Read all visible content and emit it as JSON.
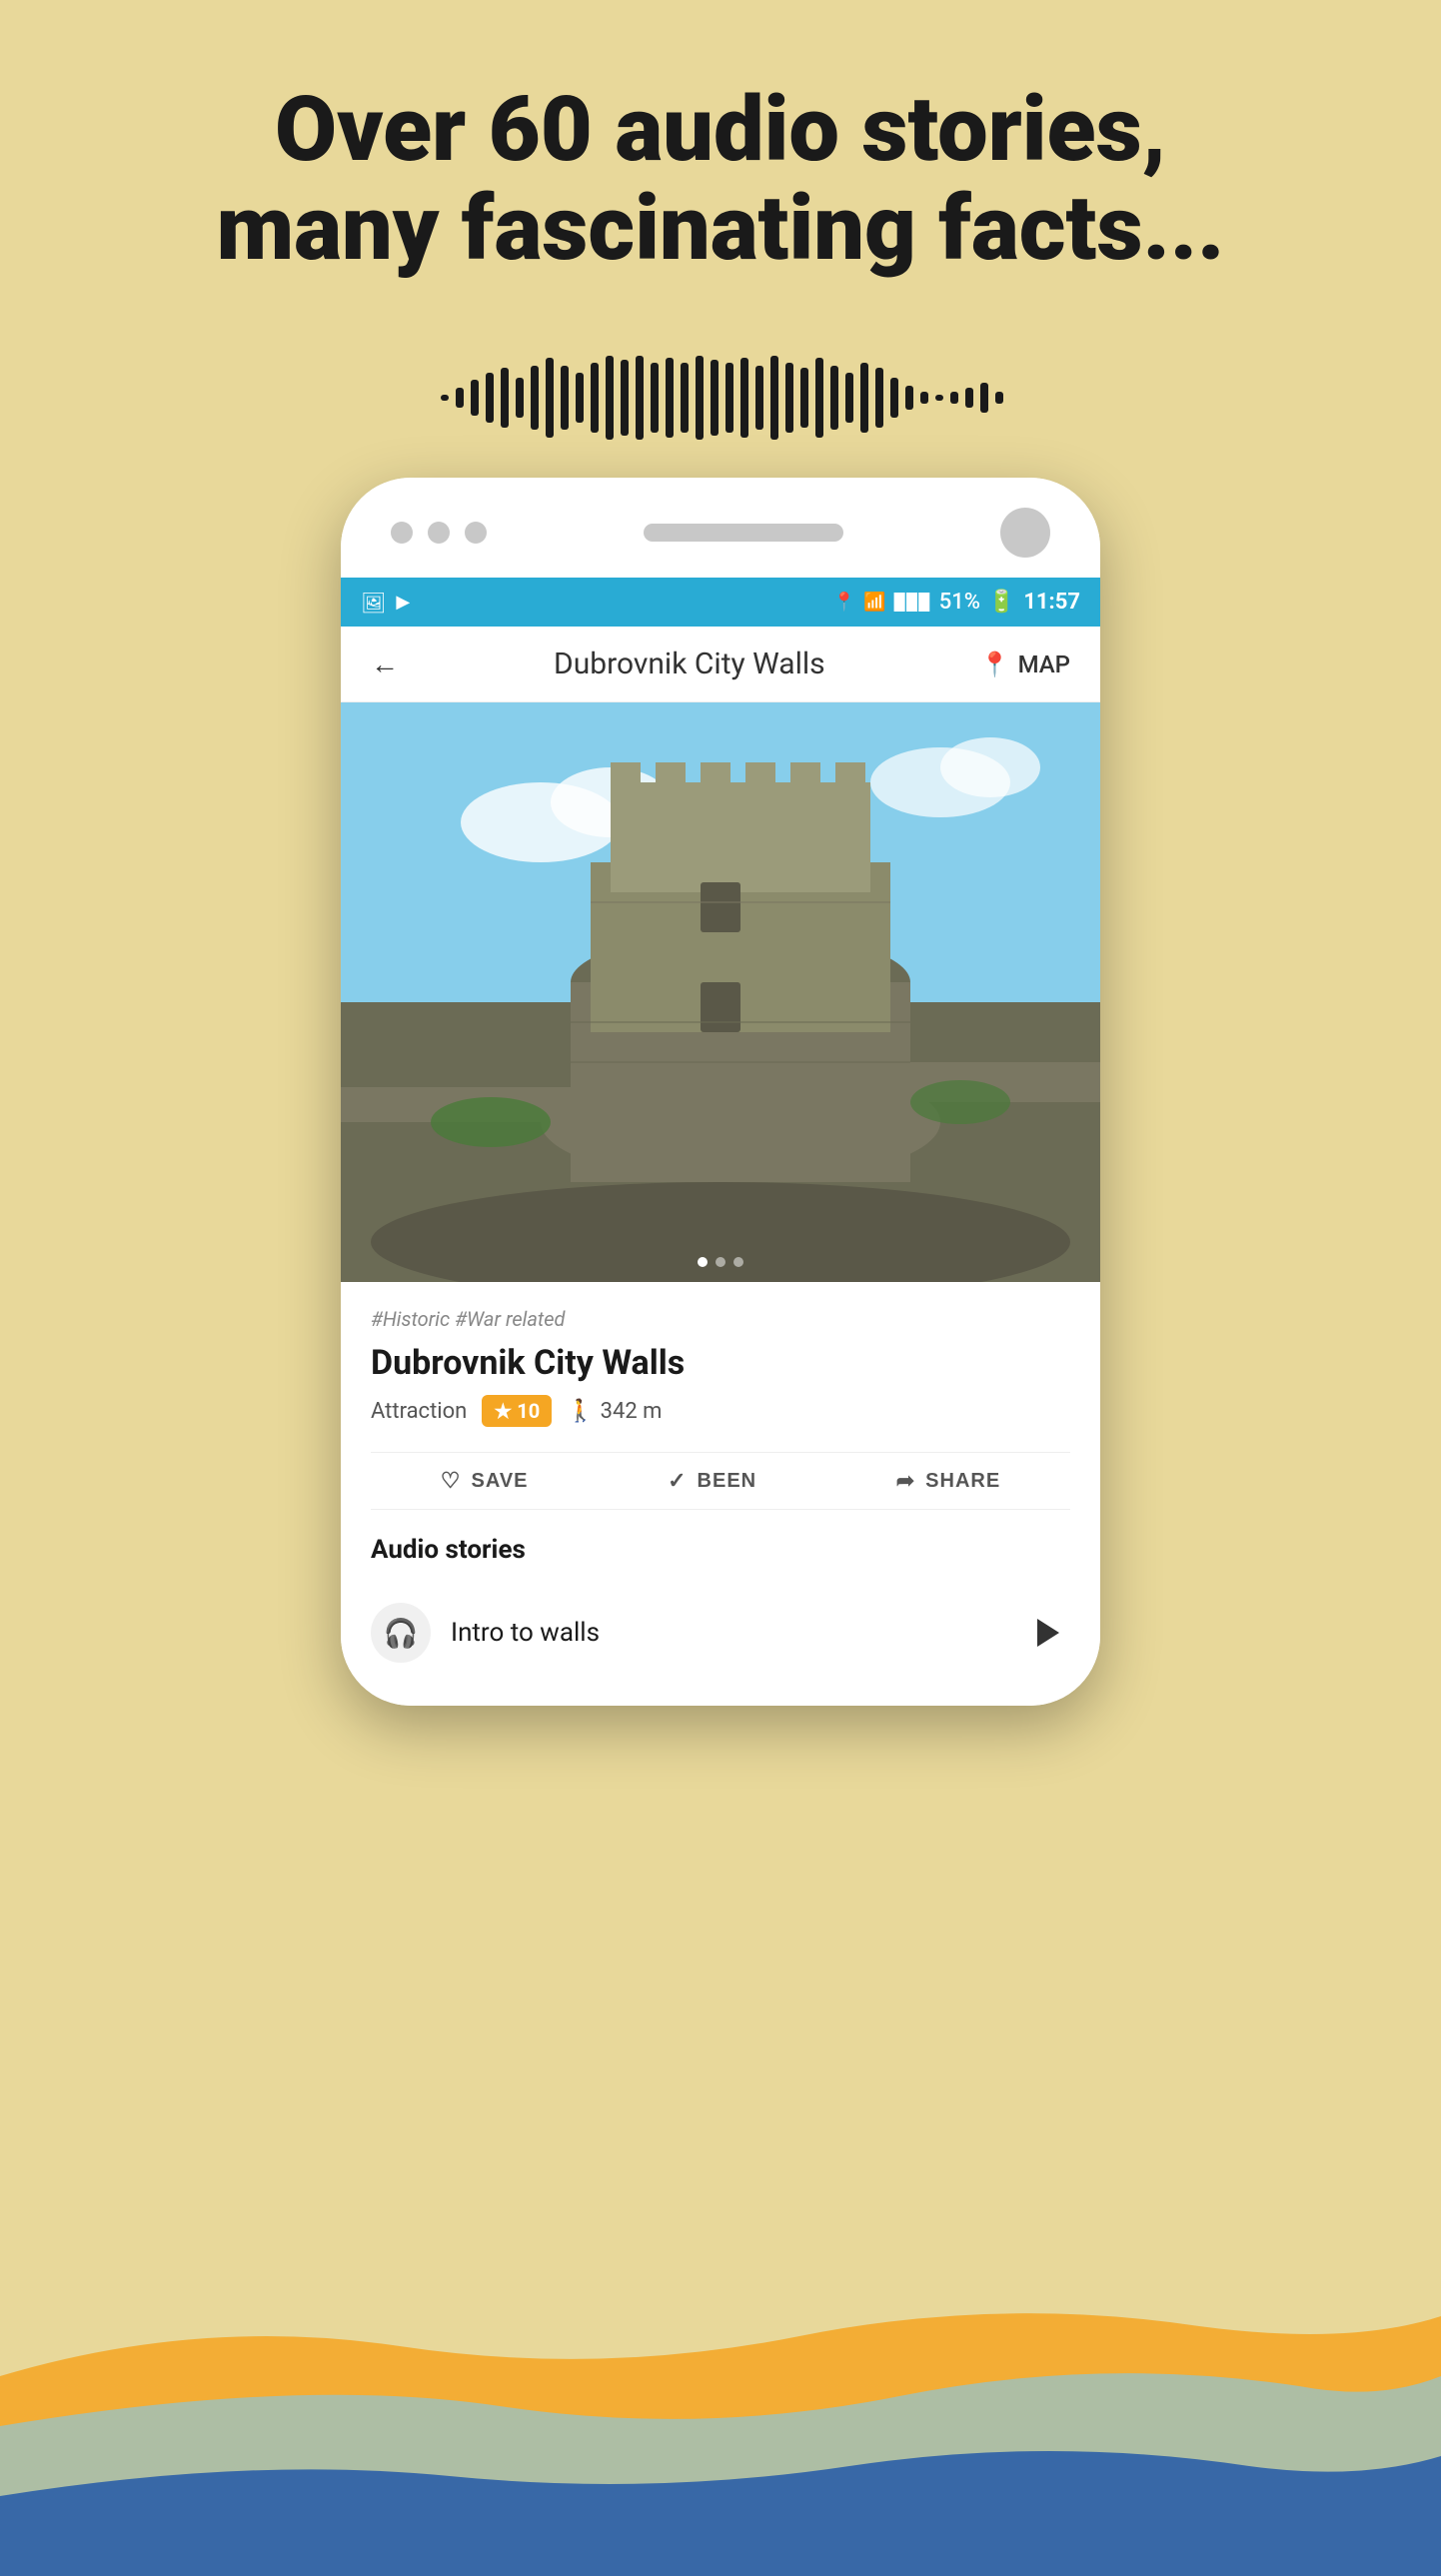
{
  "header": {
    "title_line1": "Over 60 audio stories,",
    "title_line2": "many fascinating facts..."
  },
  "status_bar": {
    "battery": "51%",
    "time": "11:57",
    "left_icons": [
      "image-icon",
      "play-icon"
    ]
  },
  "nav": {
    "title": "Dubrovnik City Walls",
    "map_label": "MAP",
    "back_label": "←"
  },
  "attraction": {
    "tags": "#Historic #War related",
    "title": "Dubrovnik City Walls",
    "type": "Attraction",
    "rating": "10",
    "distance": "342 m"
  },
  "actions": {
    "save": "SAVE",
    "been": "BEEN",
    "share": "SHARE"
  },
  "audio_section": {
    "title": "Audio stories",
    "items": [
      {
        "id": 1,
        "title": "Intro to walls"
      }
    ]
  },
  "waveform": {
    "bars": [
      4,
      8,
      16,
      24,
      32,
      20,
      40,
      55,
      40,
      32,
      48,
      60,
      48,
      36,
      55,
      45,
      55,
      40,
      30,
      20,
      32,
      22,
      14,
      8,
      4
    ]
  },
  "colors": {
    "status_bar_bg": "#29ABD4",
    "accent_blue": "#29ABD4",
    "rating_orange": "#F5A623",
    "bg_yellow": "#E8D89A",
    "wave_orange": "#F5A623",
    "wave_blue_light": "#8EC5D4",
    "wave_blue_dark": "#2B5EA7"
  }
}
